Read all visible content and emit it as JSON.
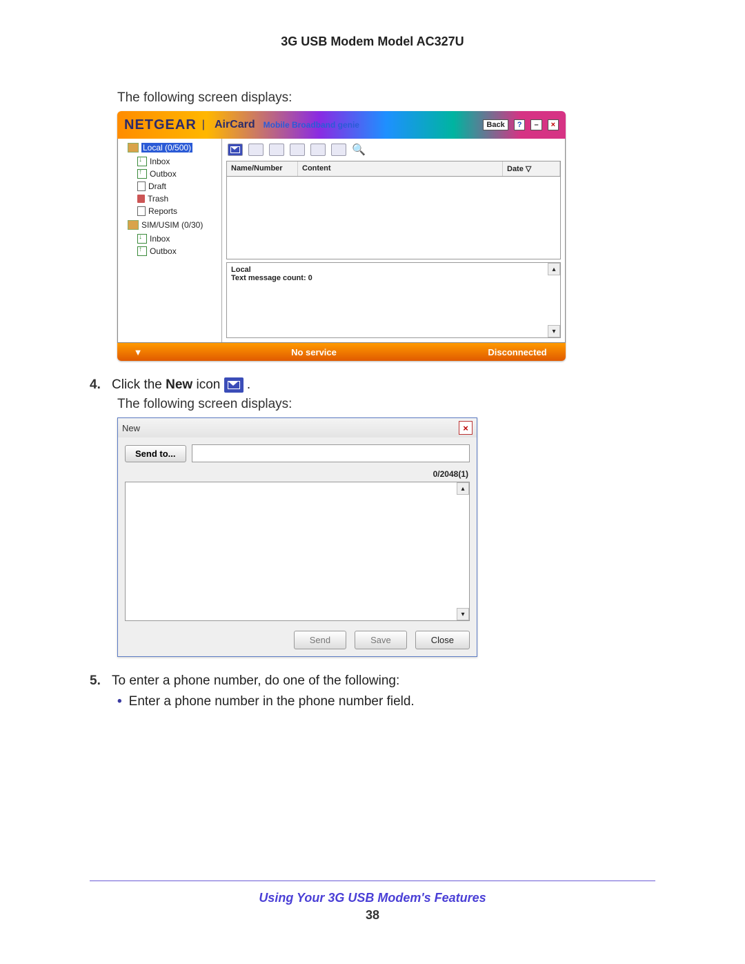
{
  "doc": {
    "header": "3G USB Modem Model AC327U",
    "intro": "The following screen displays:",
    "step4_num": "4.",
    "step4_prefix": "Click the ",
    "step4_bold": "New",
    "step4_suffix": " icon ",
    "step4_period": ".",
    "step4_after": "The following screen displays:",
    "step5_num": "5.",
    "step5_text": "To enter a phone number, do one of the following:",
    "bullet1": "Enter a phone number in the phone number field.",
    "footer_link": "Using Your 3G USB Modem's Features",
    "footer_page": "38"
  },
  "genie": {
    "brand": "NETGEAR",
    "brand_air": "AirCard",
    "brand_sub": "Mobile Broadband genie",
    "back": "Back",
    "help": "?",
    "min": "–",
    "close": "×",
    "tree": {
      "local": "Local (0/500)",
      "inbox": "Inbox",
      "outbox": "Outbox",
      "draft": "Draft",
      "trash": "Trash",
      "reports": "Reports",
      "sim": "SIM/USIM (0/30)",
      "sim_inbox": "Inbox",
      "sim_outbox": "Outbox"
    },
    "columns": {
      "name": "Name/Number",
      "content": "Content",
      "date": "Date"
    },
    "status_local": "Local",
    "status_count": "Text message count: 0",
    "bar": {
      "service": "No service",
      "conn": "Disconnected",
      "sig": "▼"
    }
  },
  "dialog": {
    "title": "New",
    "close": "×",
    "sendto": "Send to...",
    "counter": "0/2048(1)",
    "send": "Send",
    "save": "Save",
    "close_btn": "Close"
  }
}
